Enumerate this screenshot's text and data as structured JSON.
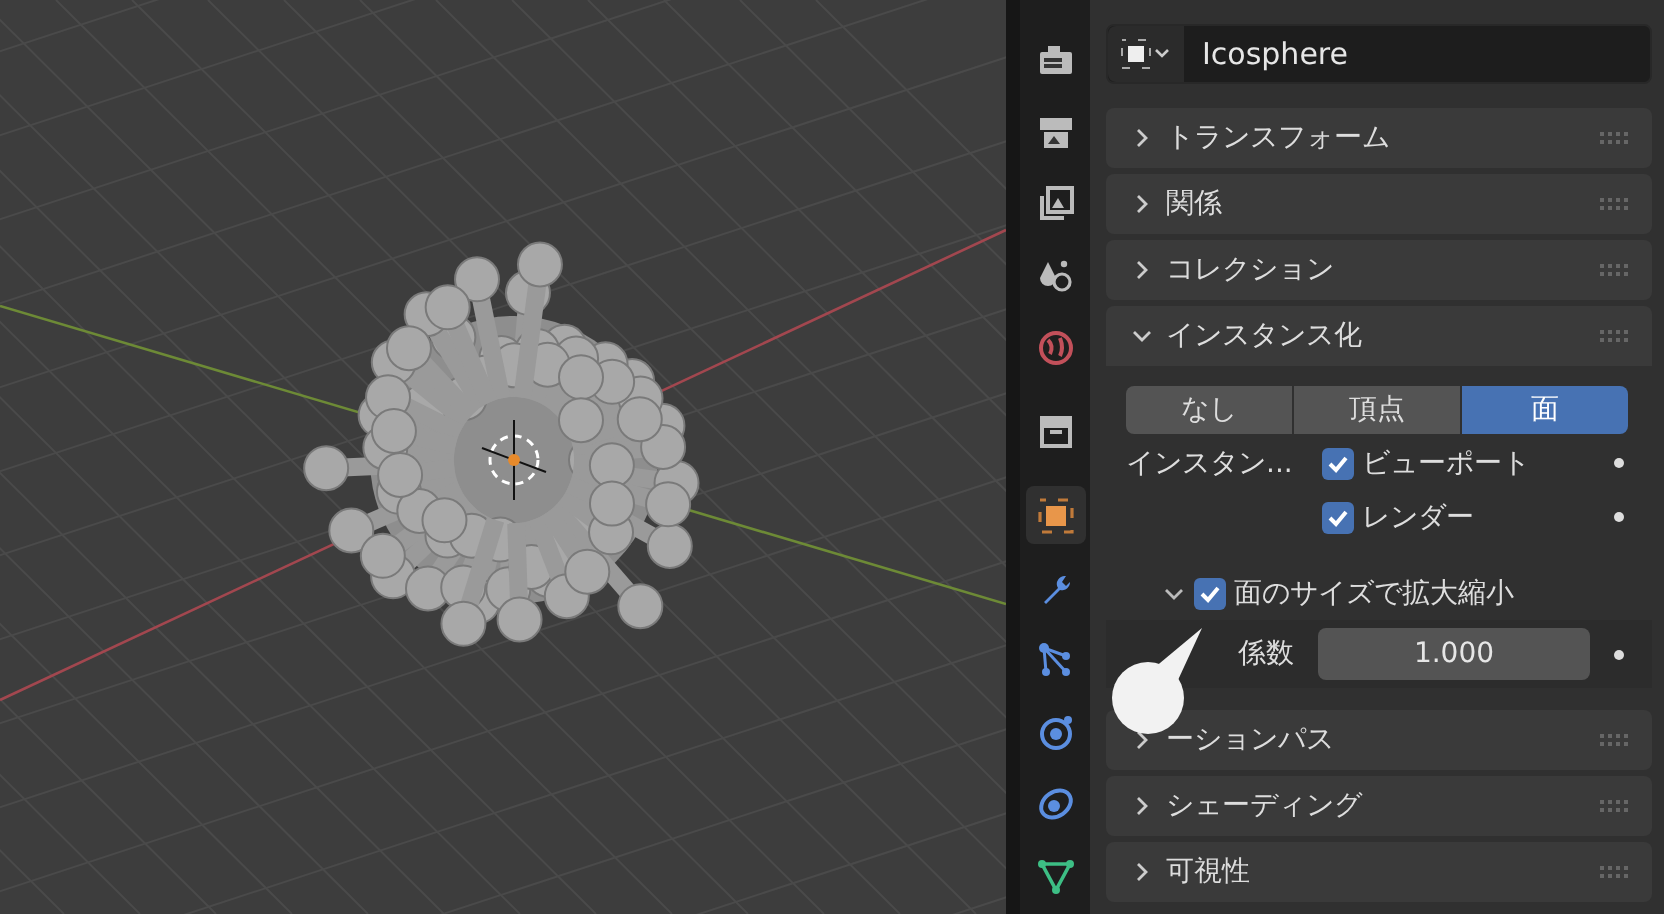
{
  "object": {
    "name": "Icosphere"
  },
  "tabs": [
    {
      "kind": "render",
      "selected": false
    },
    {
      "kind": "output",
      "selected": false
    },
    {
      "kind": "view_layer",
      "selected": false
    },
    {
      "kind": "scene",
      "selected": false
    },
    {
      "kind": "world",
      "selected": false
    },
    {
      "kind": "collection",
      "selected": false
    },
    {
      "kind": "object",
      "selected": true
    },
    {
      "kind": "modifiers",
      "selected": false
    },
    {
      "kind": "particles",
      "selected": false
    },
    {
      "kind": "physics",
      "selected": false
    },
    {
      "kind": "constraints",
      "selected": false
    },
    {
      "kind": "data",
      "selected": false
    }
  ],
  "panels": [
    {
      "title": "トランスフォーム",
      "expanded": false
    },
    {
      "title": "関係",
      "expanded": false
    },
    {
      "title": "コレクション",
      "expanded": false
    },
    {
      "title": "インスタンス化",
      "expanded": true,
      "kind": "instancing"
    },
    {
      "title": "ーションパス",
      "expanded": false
    },
    {
      "title": "シェーディング",
      "expanded": false
    },
    {
      "title": "可視性",
      "expanded": false
    }
  ],
  "instancing": {
    "modes": [
      {
        "label": "なし",
        "selected": false
      },
      {
        "label": "頂点",
        "selected": false
      },
      {
        "label": "面",
        "selected": true
      }
    ],
    "instancer_label": "インスタン...",
    "options": [
      {
        "label": "ビューポート",
        "checked": true
      },
      {
        "label": "レンダー",
        "checked": true
      }
    ],
    "scale": {
      "label": "面のサイズで拡大縮小",
      "checked": true,
      "expanded": true,
      "factor_label": "係数",
      "factor_value": "1.000"
    }
  }
}
